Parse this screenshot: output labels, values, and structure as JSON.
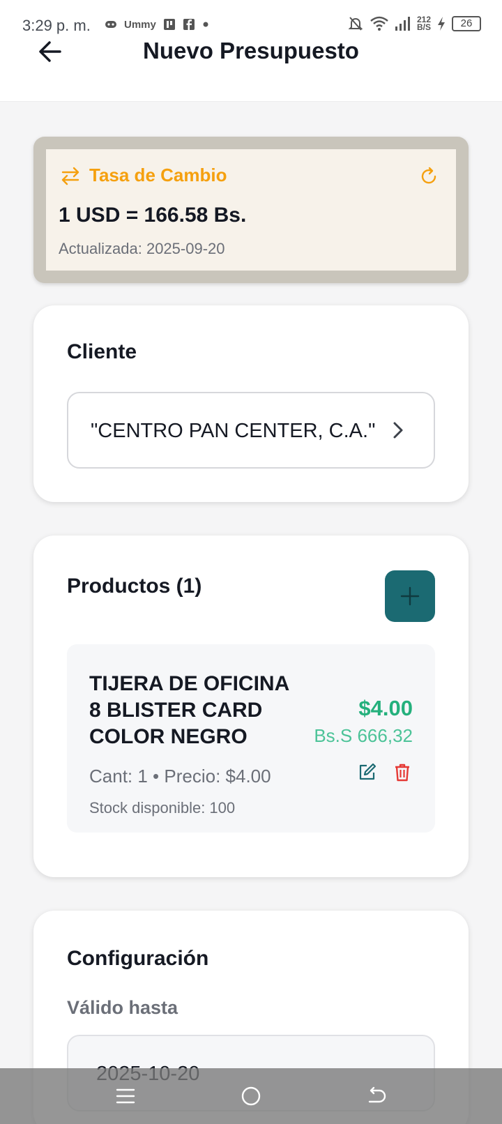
{
  "status_bar": {
    "time": "3:29 p. m.",
    "notif_text": "Ummy",
    "speed_value": "212",
    "speed_unit": "B/S",
    "battery": "26"
  },
  "header": {
    "title": "Nuevo Presupuesto"
  },
  "exchange_rate": {
    "title": "Tasa de Cambio",
    "value": "1 USD = 166.58 Bs.",
    "updated": "Actualizada: 2025-09-20",
    "accent_color": "#f5a00f"
  },
  "client": {
    "section_title": "Cliente",
    "selected": "\"CENTRO PAN CENTER, C.A.\""
  },
  "products": {
    "section_title": "Productos (1)",
    "items": [
      {
        "name": "TIJERA DE OFICINA 8 BLISTER CARD COLOR NEGRO",
        "price_usd": "$4.00",
        "price_bs": "Bs.S 666,32",
        "meta": "Cant: 1 • Precio: $4.00",
        "stock": "Stock disponible: 100"
      }
    ],
    "add_button_color": "#1b6a72"
  },
  "configuration": {
    "section_title": "Configuración",
    "valid_until_label": "Válido hasta",
    "valid_until_value": "2025-10-20"
  },
  "icons": {
    "back": "arrow-left-icon",
    "exchange": "swap-arrows-icon",
    "refresh": "refresh-icon",
    "chevron": "chevron-right-icon",
    "add": "plus-icon",
    "edit": "edit-icon",
    "delete": "trash-icon"
  }
}
